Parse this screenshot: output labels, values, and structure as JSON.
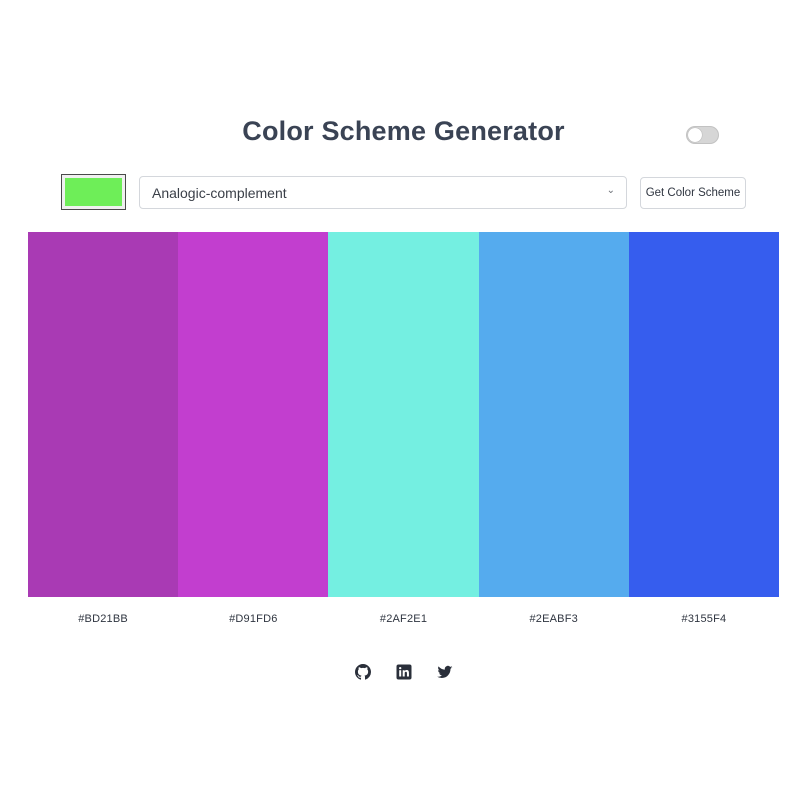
{
  "header": {
    "title": "Color Scheme Generator",
    "theme_toggle": {
      "state": "off"
    }
  },
  "controls": {
    "seed_color": "#6EEE58",
    "mode_select": {
      "selected": "Analogic-complement"
    },
    "submit_label": "Get Color Scheme"
  },
  "palette": {
    "colors": [
      {
        "hex": "#BD21BB",
        "display_color": "#A93AB4"
      },
      {
        "hex": "#D91FD6",
        "display_color": "#C23ECF"
      },
      {
        "hex": "#2AF2E1",
        "display_color": "#74EFE1"
      },
      {
        "hex": "#2EABF3",
        "display_color": "#55ABEE"
      },
      {
        "hex": "#3155F4",
        "display_color": "#365DEE"
      }
    ]
  },
  "footer": {
    "icons": [
      "github-icon",
      "linkedin-icon",
      "twitter-icon"
    ],
    "icon_color": "#2a2f3a"
  }
}
